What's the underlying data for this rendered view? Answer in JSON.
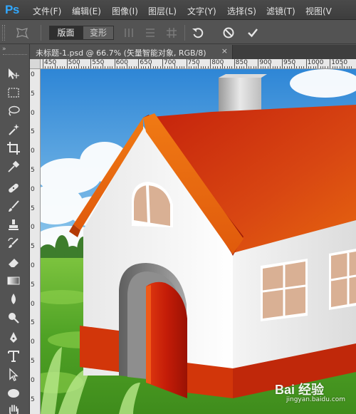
{
  "app": {
    "logo": "Ps"
  },
  "menu": [
    {
      "label": "文件(F)"
    },
    {
      "label": "编辑(E)"
    },
    {
      "label": "图像(I)"
    },
    {
      "label": "图层(L)"
    },
    {
      "label": "文字(Y)"
    },
    {
      "label": "选择(S)"
    },
    {
      "label": "滤镜(T)"
    },
    {
      "label": "视图(V"
    }
  ],
  "options": {
    "tool_icon": "puppet-warp-icon",
    "mode_active": "版面",
    "mode_inactive": "变形",
    "icons": [
      "distribute-vertical-icon",
      "distribute-horizontal-icon",
      "grid-icon",
      "undo-icon",
      "cancel-icon",
      "commit-icon"
    ]
  },
  "document": {
    "tab_title": "未标题-1.psd @ 66.7% (矢量智能对象, RGB/8)",
    "close_symbol": "×"
  },
  "ruler": {
    "horizontal": [
      "450",
      "500",
      "550",
      "600",
      "650",
      "700",
      "750",
      "800",
      "850",
      "900",
      "950",
      "1000",
      "1050"
    ],
    "vertical": [
      "0",
      "5",
      "0",
      "5",
      "0",
      "5",
      "0",
      "5",
      "0",
      "5",
      "0",
      "5",
      "0",
      "5",
      "0",
      "5",
      "0",
      "5"
    ]
  },
  "tools": [
    "move-icon",
    "marquee-icon",
    "lasso-icon",
    "magic-wand-icon",
    "crop-icon",
    "eyedropper-icon",
    "healing-brush-icon",
    "brush-icon",
    "clone-stamp-icon",
    "history-brush-icon",
    "eraser-icon",
    "gradient-icon",
    "blur-icon",
    "dodge-icon",
    "pen-icon",
    "type-icon",
    "path-selection-icon",
    "ellipse-icon",
    "hand-icon"
  ],
  "watermark": {
    "text": "Bai 经验",
    "url": "jingyan.baidu.com"
  },
  "colors": {
    "accent": "#31a8ff",
    "roof": "#d84a12",
    "wall": "#f2f2f2",
    "door": "#c01e08",
    "grass": "#5fae2c",
    "sky": "#5aa8e6"
  }
}
